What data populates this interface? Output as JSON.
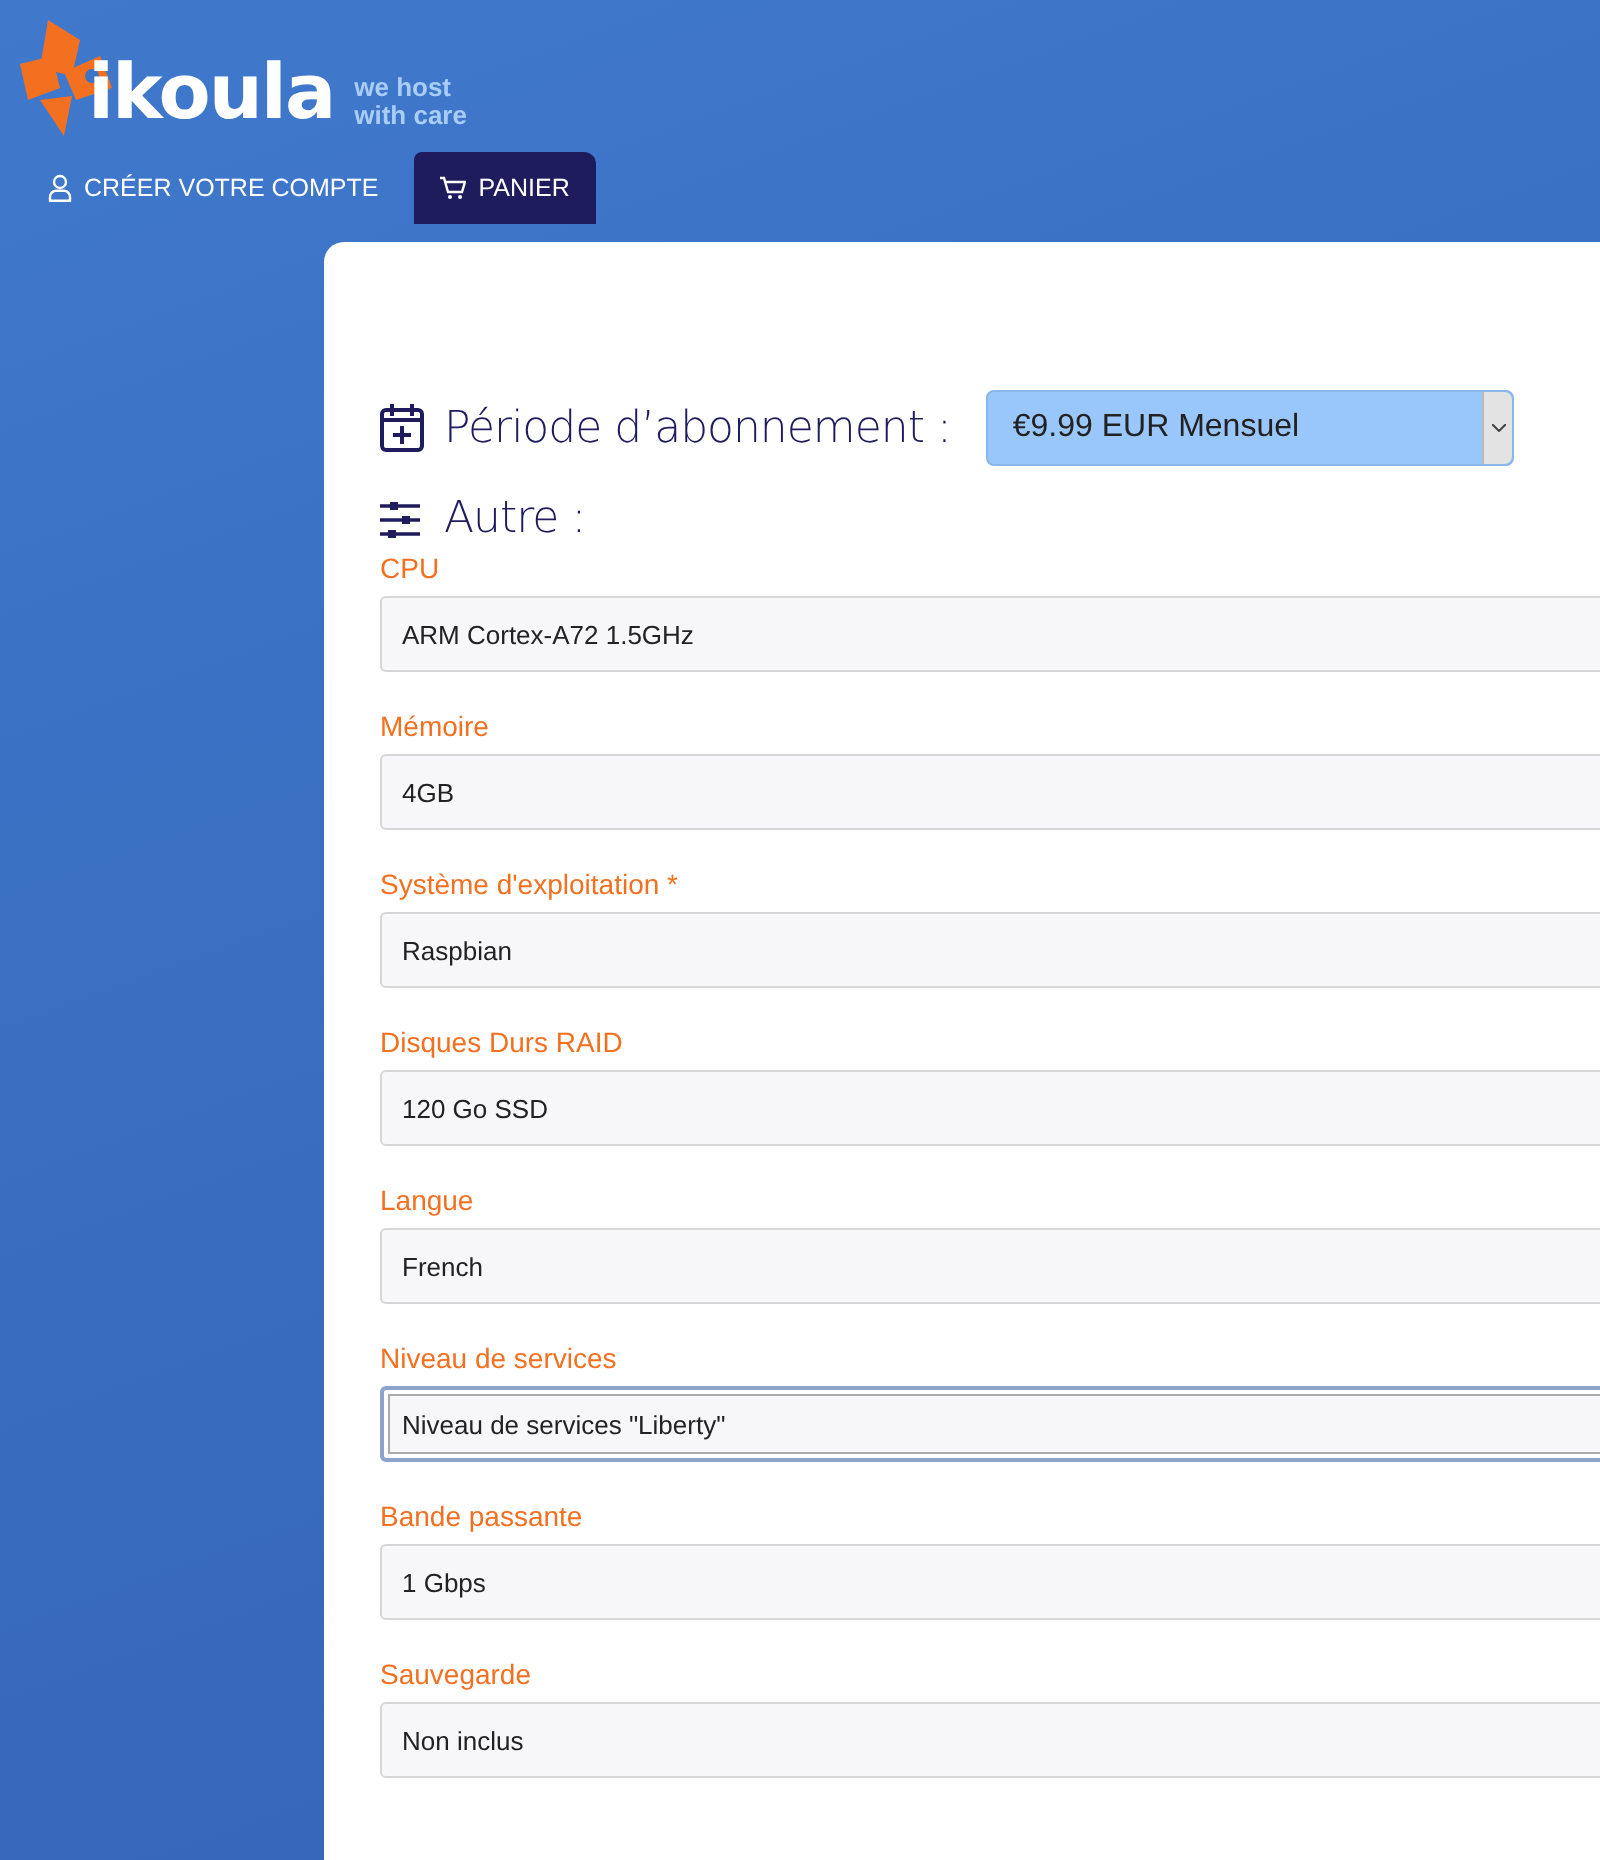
{
  "header": {
    "brand": "ikoula",
    "tagline": "we host with care",
    "nav": [
      {
        "kind": "account",
        "label": "CRÉER VOTRE COMPTE",
        "selected": false
      },
      {
        "kind": "cart",
        "label": "PANIER",
        "selected": true
      }
    ]
  },
  "period": {
    "label": "Période d’abonnement :",
    "value": "€9.99 EUR Mensuel"
  },
  "other": {
    "title": "Autre :",
    "fields": [
      {
        "label": "CPU",
        "value": "ARM Cortex-A72 1.5GHz",
        "focused": false
      },
      {
        "label": "Mémoire",
        "value": "4GB",
        "focused": false
      },
      {
        "label": "Système d'exploitation *",
        "value": "Raspbian",
        "focused": false
      },
      {
        "label": "Disques Durs RAID",
        "value": "120 Go SSD",
        "focused": false
      },
      {
        "label": "Langue",
        "value": "French",
        "focused": false
      },
      {
        "label": "Niveau de services",
        "value": "Niveau de services \"Liberty\"",
        "focused": true
      },
      {
        "label": "Bande passante",
        "value": "1 Gbps",
        "focused": false
      },
      {
        "label": "Sauvegarde",
        "value": "Non inclus",
        "focused": false
      }
    ]
  }
}
